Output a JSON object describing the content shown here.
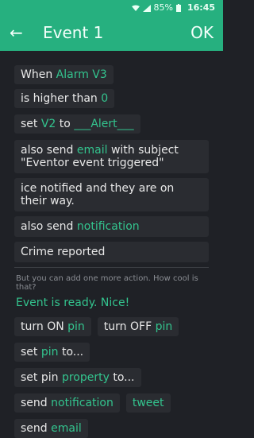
{
  "status": {
    "battery": "85%",
    "time": "16:45"
  },
  "appbar": {
    "title": "Event 1",
    "ok_label": "OK"
  },
  "rule": {
    "when_label": "When",
    "pin": "Alarm V3",
    "condition": "is higher than",
    "value": "0"
  },
  "set": {
    "label": "set",
    "pin": "V2",
    "to_label": "to",
    "value": "___Alert___"
  },
  "email_action": {
    "prefix": "also send",
    "channel": "email",
    "suffix": "with subject",
    "subject": "\"Eventor event triggered\"",
    "body": "ice notified and they are on their way."
  },
  "notification_action": {
    "prefix": "also send",
    "channel": "notification",
    "message": "Crime reported"
  },
  "hint": "But you can add one more action. How cool is that?",
  "ready": "Event is ready. Nice!",
  "actions": [
    {
      "pre": "turn ON",
      "hl": "pin",
      "post": ""
    },
    {
      "pre": "turn OFF",
      "hl": "pin",
      "post": ""
    },
    {
      "pre": "set",
      "hl": "pin",
      "post": "to..."
    },
    {
      "pre": "set pin",
      "hl": "property",
      "post": "to..."
    },
    {
      "pre": "send",
      "hl": "notification",
      "post": ""
    },
    {
      "pre": "",
      "hl": "tweet",
      "post": ""
    },
    {
      "pre": "send",
      "hl": "email",
      "post": ""
    }
  ]
}
